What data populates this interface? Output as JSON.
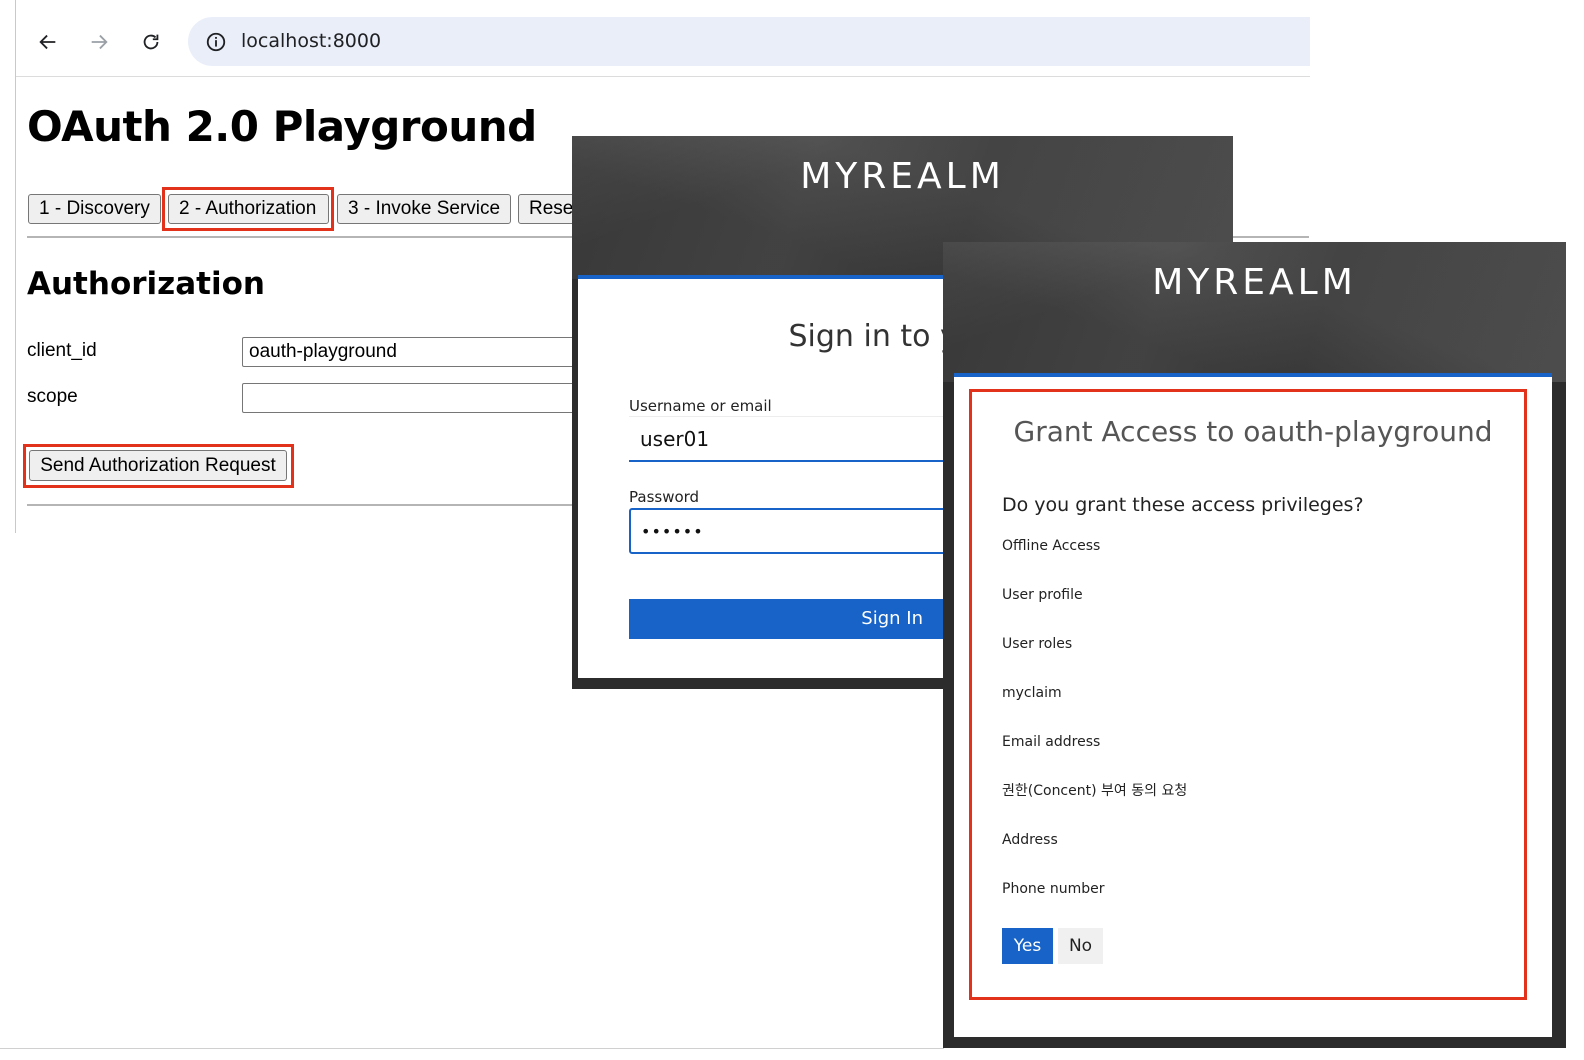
{
  "browser": {
    "url": "localhost:8000"
  },
  "playground": {
    "title": "OAuth 2.0 Playground",
    "tabs": [
      {
        "label": "1 - Discovery"
      },
      {
        "label": "2 - Authorization",
        "highlighted": true
      },
      {
        "label": "3 - Invoke Service"
      },
      {
        "label": "Rese"
      }
    ],
    "section_title": "Authorization",
    "fields": [
      {
        "label": "client_id",
        "value": "oauth-playground"
      },
      {
        "label": "scope",
        "value": ""
      }
    ],
    "send_button": "Send Authorization Request"
  },
  "login": {
    "realm": "MYREALM",
    "title": "Sign in to your",
    "username_label": "Username or email",
    "username_value": "user01",
    "password_label": "Password",
    "password_value": "••••••",
    "signin_button": "Sign In"
  },
  "consent": {
    "realm": "MYREALM",
    "title": "Grant Access to oauth-playground",
    "question": "Do you grant these access privileges?",
    "privileges": [
      "Offline Access",
      "User profile",
      "User roles",
      "myclaim",
      "Email address",
      "권한(Concent) 부여 동의 요청",
      "Address",
      "Phone number"
    ],
    "yes_button": "Yes",
    "no_button": "No"
  },
  "colors": {
    "accent": "#1763c7",
    "highlight": "#e2321c",
    "header_dark": "#3d3d3d"
  }
}
